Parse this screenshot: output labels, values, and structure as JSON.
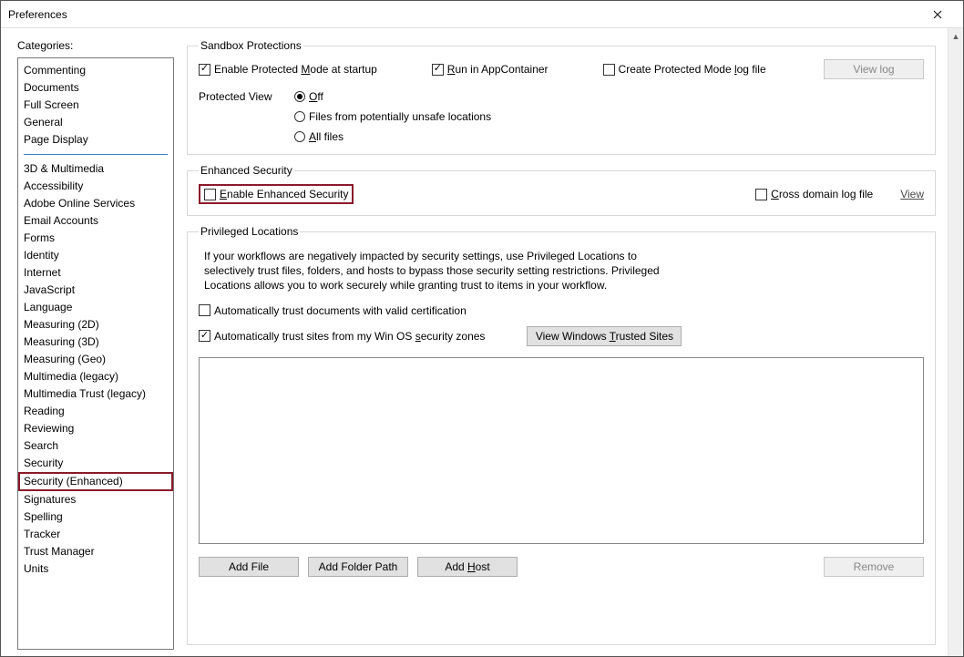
{
  "window": {
    "title": "Preferences"
  },
  "categories": {
    "label": "Categories:",
    "group1": [
      "Commenting",
      "Documents",
      "Full Screen",
      "General",
      "Page Display"
    ],
    "group2": [
      "3D & Multimedia",
      "Accessibility",
      "Adobe Online Services",
      "Email Accounts",
      "Forms",
      "Identity",
      "Internet",
      "JavaScript",
      "Language",
      "Measuring (2D)",
      "Measuring (3D)",
      "Measuring (Geo)",
      "Multimedia (legacy)",
      "Multimedia Trust (legacy)",
      "Reading",
      "Reviewing",
      "Search",
      "Security",
      "Security (Enhanced)",
      "Signatures",
      "Spelling",
      "Tracker",
      "Trust Manager",
      "Units"
    ],
    "selected": "Security (Enhanced)"
  },
  "sandbox": {
    "legend": "Sandbox Protections",
    "protectedMode": {
      "label_pre": "Enable Protected ",
      "label_u": "M",
      "label_post": "ode at startup",
      "checked": true
    },
    "appContainer": {
      "label_pre": "",
      "label_u": "R",
      "label_post": "un in AppContainer",
      "checked": true
    },
    "logFile": {
      "label_pre": "Create Protected Mode ",
      "label_u": "l",
      "label_post": "og file",
      "checked": false
    },
    "viewLogBtn": "View log",
    "protectedViewLabel": "Protected View",
    "pv_off": {
      "label_u": "O",
      "label_post": "ff",
      "selected": true
    },
    "pv_unsafe": {
      "label_pre": "Files from potentially unsafe locations",
      "selected": false
    },
    "pv_all": {
      "label_u": "A",
      "label_post": "ll files",
      "selected": false
    }
  },
  "enhanced": {
    "legend": "Enhanced Security",
    "enable": {
      "label_u": "E",
      "label_post": "nable Enhanced Security",
      "checked": false
    },
    "crossDomain": {
      "label_u": "C",
      "label_post": "ross domain log file",
      "checked": false
    },
    "viewLink": "View"
  },
  "privileged": {
    "legend": "Privileged Locations",
    "text": "If your workflows are negatively impacted by security settings, use Privileged Locations to selectively trust files, folders, and hosts to bypass those security setting restrictions. Privileged Locations allows you to work securely while granting trust to items in your workflow.",
    "autoCert": {
      "label": "Automatically trust documents with valid certification",
      "checked": false
    },
    "autoSites": {
      "label_pre": "Automatically trust sites from my Win OS ",
      "label_u": "s",
      "label_post": "ecurity zones",
      "checked": true
    },
    "viewTrustedBtn": {
      "pre": "View Windows ",
      "u": "T",
      "post": "rusted Sites"
    },
    "addFile": "Add File",
    "addFolder": "Add Folder Path",
    "addHost": {
      "pre": "Add ",
      "u": "H",
      "post": "ost"
    },
    "remove": "Remove"
  }
}
